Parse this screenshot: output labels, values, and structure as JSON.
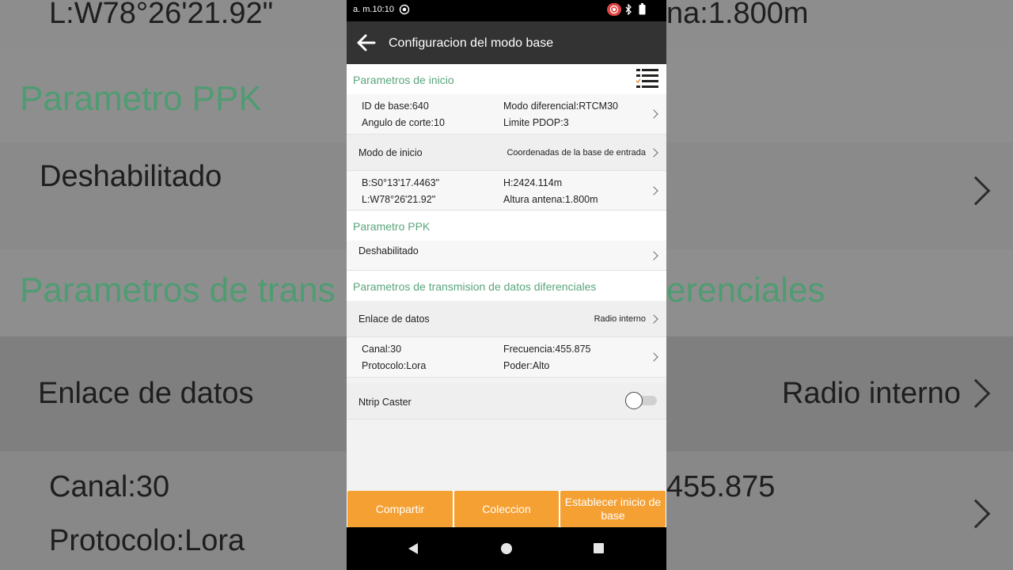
{
  "background": {
    "lines": [
      {
        "text": "L:W78°26'21.92\""
      },
      {
        "text": "na:1.800m"
      },
      {
        "text": "Parametro PPK"
      },
      {
        "text": "Deshabilitado"
      },
      {
        "text": "Parametros de trans"
      },
      {
        "text": "erenciales"
      },
      {
        "text": "Enlace de datos"
      },
      {
        "text": "Radio interno"
      },
      {
        "text": "Canal:30"
      },
      {
        "text": "455.875"
      },
      {
        "text": "Protocolo:Lora"
      }
    ]
  },
  "status_bar": {
    "time": "a. m.10:10",
    "icons": [
      "focus-icon",
      "record-icon",
      "bluetooth-icon",
      "battery-icon"
    ]
  },
  "app_bar": {
    "title": "Configuracion del modo base",
    "back_icon": "arrow-left-icon"
  },
  "sections": {
    "start": {
      "header": "Parametros de inicio",
      "base_params": {
        "base_id": "ID de base:640",
        "diff_mode": "Modo diferencial:RTCM30",
        "cutoff_angle": "Angulo de corte:10",
        "pdop_limit": "Limite PDOP:3"
      },
      "start_mode": {
        "label": "Modo de inicio",
        "value": "Coordenadas de la base de entrada"
      },
      "coordinates": {
        "lat": "B:S0°13'17.4463\"",
        "height": "H:2424.114m",
        "lon": "L:W78°26'21.92\"",
        "antenna": "Altura antena:1.800m"
      }
    },
    "ppk": {
      "header": "Parametro PPK",
      "value": "Deshabilitado"
    },
    "transmission": {
      "header": "Parametros de transmision de datos diferenciales",
      "data_link": {
        "label": "Enlace de datos",
        "value": "Radio interno"
      },
      "radio": {
        "channel": "Canal:30",
        "frequency": "Frecuencia:455.875",
        "protocol": "Protocolo:Lora",
        "power": "Poder:Alto"
      },
      "ntrip": {
        "label": "Ntrip Caster",
        "enabled": false
      }
    }
  },
  "buttons": {
    "share": "Compartir",
    "collection": "Coleccion",
    "start_base": "Establecer inicio de base"
  },
  "colors": {
    "accent_green": "#5aa57b",
    "button_orange": "#f5a033",
    "app_bar": "#333333"
  }
}
